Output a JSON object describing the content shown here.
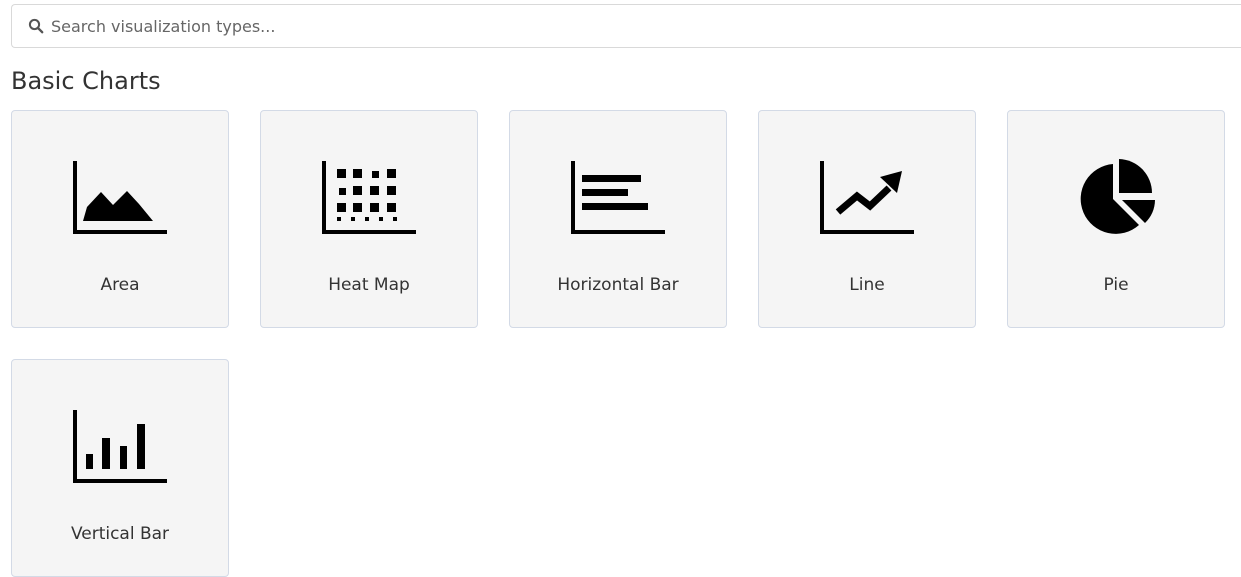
{
  "search": {
    "placeholder": "Search visualization types...",
    "icon": "search-icon"
  },
  "section": {
    "title": "Basic Charts"
  },
  "visualizations": [
    {
      "label": "Area",
      "icon": "area-chart-icon"
    },
    {
      "label": "Heat Map",
      "icon": "heat-map-icon"
    },
    {
      "label": "Horizontal Bar",
      "icon": "horizontal-bar-chart-icon"
    },
    {
      "label": "Line",
      "icon": "line-chart-icon"
    },
    {
      "label": "Pie",
      "icon": "pie-chart-icon"
    },
    {
      "label": "Vertical Bar",
      "icon": "vertical-bar-chart-icon"
    }
  ],
  "colors": {
    "card_background": "#f5f5f5",
    "card_border": "#d3dae6",
    "icon": "#000000",
    "text": "#333333"
  }
}
